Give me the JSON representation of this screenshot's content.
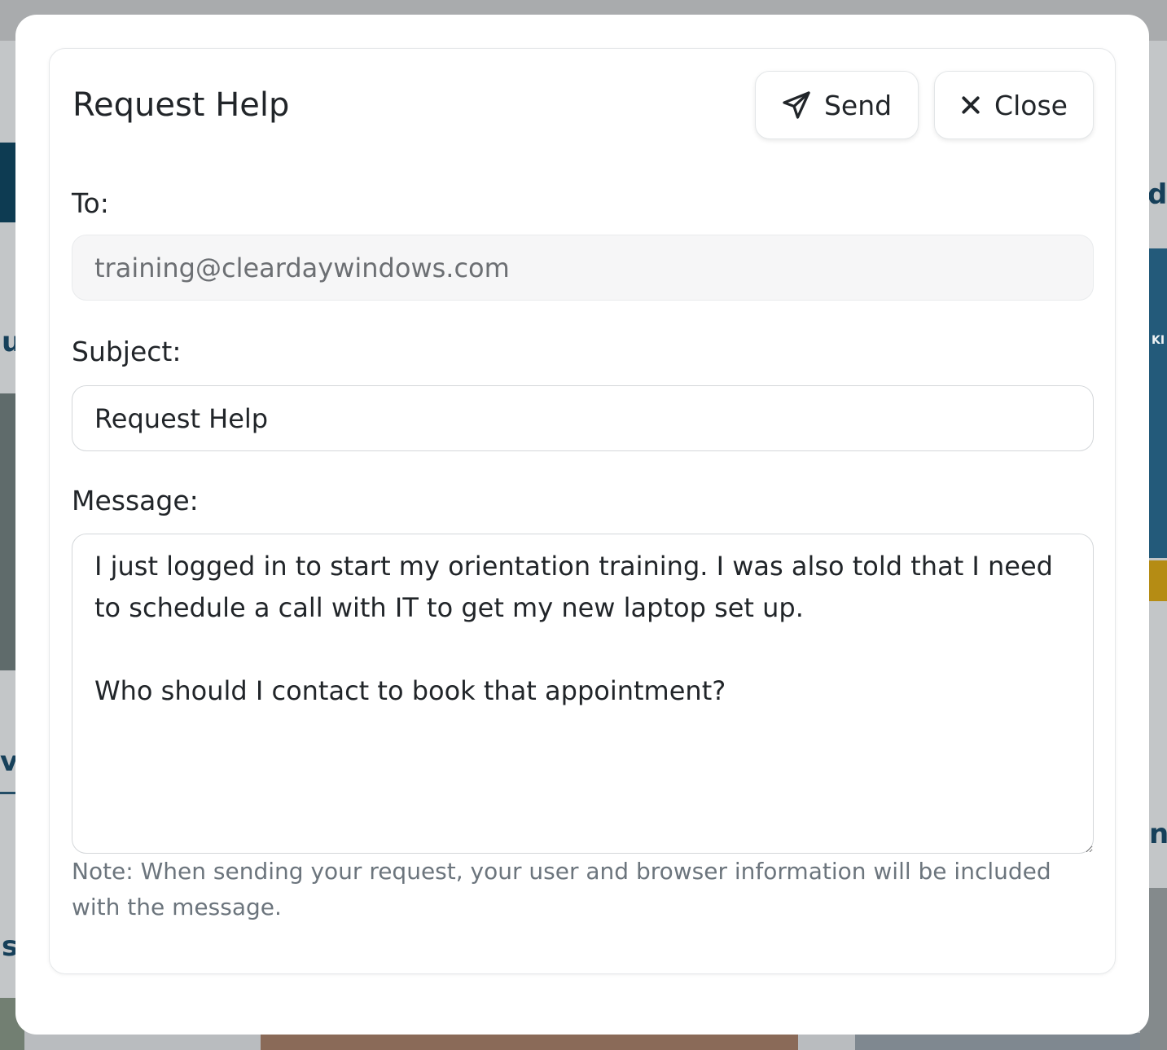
{
  "background": {
    "fragments": [
      "u",
      "v",
      "s",
      "d",
      "n"
    ],
    "tag": "KI"
  },
  "dialog": {
    "title": "Request Help",
    "send_label": "Send",
    "close_label": "Close",
    "to_label": "To:",
    "to_value": "training@cleardaywindows.com",
    "subject_label": "Subject:",
    "subject_value": "Request Help",
    "message_label": "Message:",
    "message_value": "I just logged in to start my orientation training. I was also told that I need to schedule a call with IT to get my new laptop set up.\n\nWho should I contact to book that appointment?",
    "note": "Note: When sending your request, your user and browser information will be included with the message."
  },
  "icons": {
    "send": "paper-plane-icon",
    "close": "x-close-icon"
  },
  "colors": {
    "text": "#212529",
    "muted": "#6c757d",
    "readonly_field_bg": "#f6f6f7",
    "border": "#dcdfe2",
    "overlay": "#b9bcbf"
  }
}
